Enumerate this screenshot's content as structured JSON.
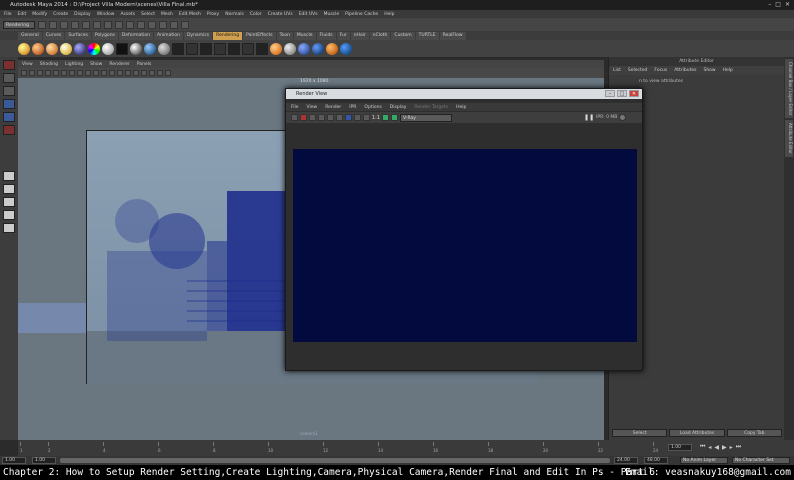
{
  "app": {
    "title": "Autodesk Maya 2014 : D:\\Project Villa Modern\\scenes\\Villa Final.mb*",
    "menu": [
      "File",
      "Edit",
      "Modify",
      "Create",
      "Display",
      "Window",
      "Assets",
      "Select",
      "Mesh",
      "Edit Mesh",
      "Proxy",
      "Normals",
      "Color",
      "Create UVs",
      "Edit UVs",
      "Muscle",
      "Pipeline Cache",
      "Help"
    ],
    "mode_dropdown": "Rendering"
  },
  "shelf": {
    "tabs": [
      "General",
      "Curves",
      "Surfaces",
      "Polygons",
      "Deformation",
      "Animation",
      "Dynamics",
      "Rendering",
      "PaintEffects",
      "Toon",
      "Muscle",
      "Fluids",
      "Fur",
      "nHair",
      "nCloth",
      "Custom",
      "TURTLE",
      "RealFlow"
    ],
    "active_tab": "Rendering"
  },
  "viewport": {
    "menu": [
      "View",
      "Shading",
      "Lighting",
      "Show",
      "Renderer",
      "Panels"
    ],
    "resolution_label": "1920 x 1080",
    "camera_label": "camera1"
  },
  "attribute_editor": {
    "title": "Attribute Editor",
    "menu": [
      "List",
      "Selected",
      "Focus",
      "Attributes",
      "Show",
      "Help"
    ],
    "message": "n to view attributes",
    "buttons": [
      "Select",
      "Load Attributes",
      "Copy Tab"
    ]
  },
  "side_tabs": [
    "Channel Box / Layer Editor",
    "Attribute Editor"
  ],
  "render_view": {
    "title": "Render View",
    "menu": [
      "File",
      "View",
      "Render",
      "IPR",
      "Options",
      "Display",
      "Render Targets",
      "Help"
    ],
    "ratio": "1:1",
    "renderer": "V-Ray",
    "status": "IPR: 0 MB",
    "canvas_color": "#030a3e"
  },
  "timeline": {
    "ticks": [
      "1",
      "2",
      "4",
      "6",
      "8",
      "10",
      "12",
      "14",
      "16",
      "18",
      "20",
      "22",
      "24"
    ],
    "current_frame": "1.00",
    "range_start": "1.00",
    "range_start_inner": "1.00",
    "range_end_inner": "24.00",
    "range_end": "48.00",
    "anim_layer": "No Anim Layer",
    "char_set": "No Character Set"
  },
  "caption": {
    "left": "Chapter 2: How to Setup Render Setting,Create Lighting,Camera,Physical Camera,Render Final and Edit In Ps - Part 6",
    "right": "Email: veasnakuy168@gmail.com"
  }
}
